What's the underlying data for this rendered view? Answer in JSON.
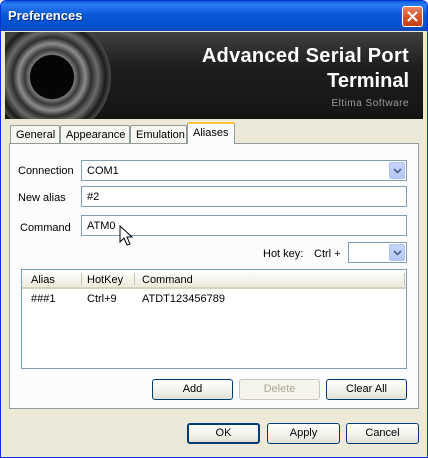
{
  "window": {
    "title": "Preferences"
  },
  "banner": {
    "line1": "Advanced Serial Port",
    "line2": "Terminal",
    "vendor": "Eltima Software"
  },
  "tabs": [
    {
      "label": "General"
    },
    {
      "label": "Appearance"
    },
    {
      "label": "Emulation"
    },
    {
      "label": "Aliases"
    }
  ],
  "form": {
    "connection_label": "Connection",
    "connection_value": "COM1",
    "new_alias_label": "New alias",
    "new_alias_value": "#2",
    "command_label": "Command",
    "command_value": "ATM0",
    "hotkey_label": "Hot key:",
    "hotkey_prefix": "Ctrl +",
    "hotkey_value": ""
  },
  "table": {
    "columns": [
      "Alias",
      "HotKey",
      "Command"
    ],
    "rows": [
      {
        "alias": "###1",
        "hotkey": "Ctrl+9",
        "command": "ATDT123456789"
      }
    ]
  },
  "panel_buttons": {
    "add": "Add",
    "delete": "Delete",
    "clear_all": "Clear All"
  },
  "dialog_buttons": {
    "ok": "OK",
    "apply": "Apply",
    "cancel": "Cancel"
  },
  "colors": {
    "titlebar": "#0a58d6",
    "dialog_bg": "#ece9d8",
    "active_tab_accent": "#ffc73c",
    "field_border": "#7f9db9"
  }
}
